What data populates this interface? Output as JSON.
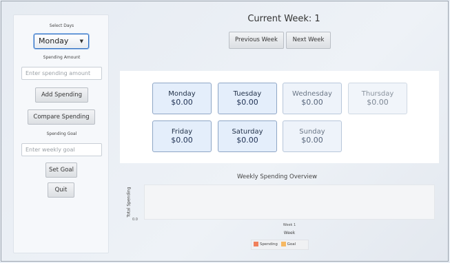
{
  "sidebar": {
    "select_days_label": "Select Days",
    "selected_day": "Monday",
    "spending_amount_label": "Spending Amount",
    "spending_placeholder": "Enter spending amount",
    "add_spending": "Add Spending",
    "compare_spending": "Compare Spending",
    "spending_goal_label": "Spending Goal",
    "goal_placeholder": "Enter weekly goal",
    "set_goal": "Set Goal",
    "quit": "Quit"
  },
  "header": {
    "current_week": "Current Week: 1",
    "previous_week": "Previous Week",
    "next_week": "Next Week"
  },
  "days": [
    {
      "name": "Monday",
      "amount": "$0.00"
    },
    {
      "name": "Tuesday",
      "amount": "$0.00"
    },
    {
      "name": "Wednesday",
      "amount": "$0.00"
    },
    {
      "name": "Thursday",
      "amount": "$0.00"
    },
    {
      "name": "Friday",
      "amount": "$0.00"
    },
    {
      "name": "Saturday",
      "amount": "$0.00"
    },
    {
      "name": "Sunday",
      "amount": "$0.00"
    }
  ],
  "colors": {
    "spending": "#f07f5a",
    "goal": "#f6b862"
  },
  "chart_data": {
    "type": "bar",
    "title": "Weekly Spending Overview",
    "xlabel": "Week",
    "ylabel": "Total Spending",
    "categories": [
      "Week 1"
    ],
    "series": [
      {
        "name": "Spending",
        "values": [
          0
        ]
      },
      {
        "name": "Goal",
        "values": [
          0
        ]
      }
    ],
    "y_tick": "0.0",
    "legend": "bottom"
  }
}
